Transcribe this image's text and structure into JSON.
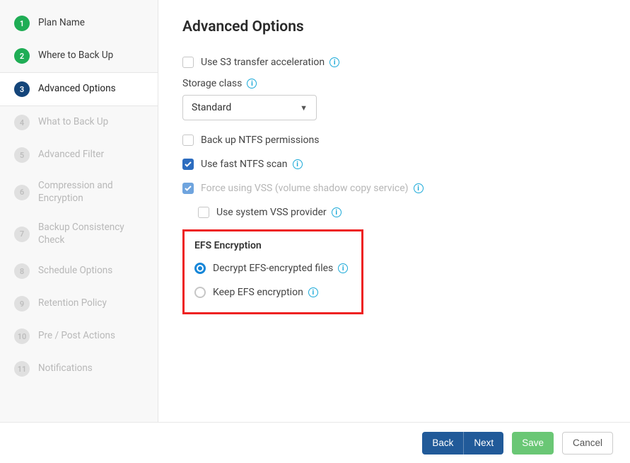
{
  "sidebar": {
    "items": [
      {
        "index": "1",
        "label": "Plan Name",
        "status": "done"
      },
      {
        "index": "2",
        "label": "Where to Back Up",
        "status": "done"
      },
      {
        "index": "3",
        "label": "Advanced Options",
        "status": "current"
      },
      {
        "index": "4",
        "label": "What to Back Up",
        "status": "pending"
      },
      {
        "index": "5",
        "label": "Advanced Filter",
        "status": "pending"
      },
      {
        "index": "6",
        "label": "Compression and Encryption",
        "status": "pending"
      },
      {
        "index": "7",
        "label": "Backup Consistency Check",
        "status": "pending"
      },
      {
        "index": "8",
        "label": "Schedule Options",
        "status": "pending"
      },
      {
        "index": "9",
        "label": "Retention Policy",
        "status": "pending"
      },
      {
        "index": "10",
        "label": "Pre / Post Actions",
        "status": "pending"
      },
      {
        "index": "11",
        "label": "Notifications",
        "status": "pending"
      }
    ]
  },
  "main": {
    "title": "Advanced Options",
    "s3_transfer": "Use S3 transfer acceleration",
    "storage_class_label": "Storage class",
    "storage_class_value": "Standard",
    "backup_ntfs": "Back up NTFS permissions",
    "use_fast_ntfs": "Use fast NTFS scan",
    "force_vss": "Force using VSS (volume shadow copy service)",
    "use_system_vss": "Use system VSS provider",
    "efs": {
      "heading": "EFS Encryption",
      "decrypt": "Decrypt EFS-encrypted files",
      "keep": "Keep EFS encryption"
    }
  },
  "footer": {
    "back": "Back",
    "next": "Next",
    "save": "Save",
    "cancel": "Cancel"
  },
  "info_glyph": "i"
}
